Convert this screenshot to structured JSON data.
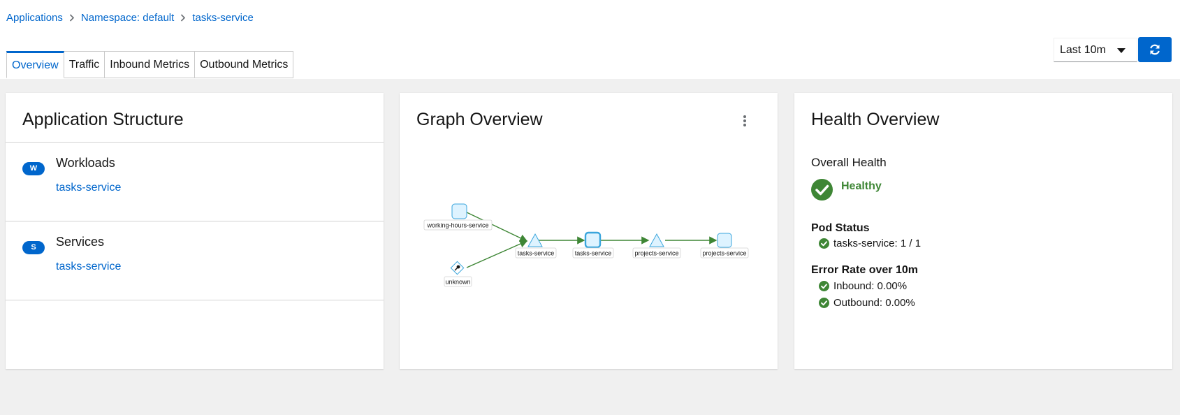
{
  "breadcrumb": {
    "items": [
      "Applications",
      "Namespace: default",
      "tasks-service"
    ]
  },
  "tabs": [
    {
      "label": "Overview",
      "active": true
    },
    {
      "label": "Traffic",
      "active": false
    },
    {
      "label": "Inbound Metrics",
      "active": false
    },
    {
      "label": "Outbound Metrics",
      "active": false
    }
  ],
  "toolbar": {
    "duration": "Last 10m"
  },
  "app_structure": {
    "title": "Application Structure",
    "workloads": {
      "badge": "W",
      "heading": "Workloads",
      "items": [
        "tasks-service"
      ]
    },
    "services": {
      "badge": "S",
      "heading": "Services",
      "items": [
        "tasks-service"
      ]
    }
  },
  "graph": {
    "title": "Graph Overview",
    "nodes": [
      {
        "label": "working-hours-service",
        "shape": "square"
      },
      {
        "label": "unknown",
        "shape": "diamond"
      },
      {
        "label": "tasks-service",
        "shape": "triangle"
      },
      {
        "label": "tasks-service",
        "shape": "square-selected"
      },
      {
        "label": "projects-service",
        "shape": "triangle"
      },
      {
        "label": "projects-service",
        "shape": "square"
      }
    ],
    "edge_color": "#3e8635"
  },
  "health": {
    "title": "Health Overview",
    "overall_label": "Overall Health",
    "overall_status": "Healthy",
    "pod_status_label": "Pod Status",
    "pod_status": "tasks-service: 1 / 1",
    "error_rate_label": "Error Rate over 10m",
    "inbound": "Inbound: 0.00%",
    "outbound": "Outbound: 0.00%"
  },
  "colors": {
    "accent": "#0066cc",
    "success": "#3e8635",
    "background": "#f0f0f0"
  }
}
